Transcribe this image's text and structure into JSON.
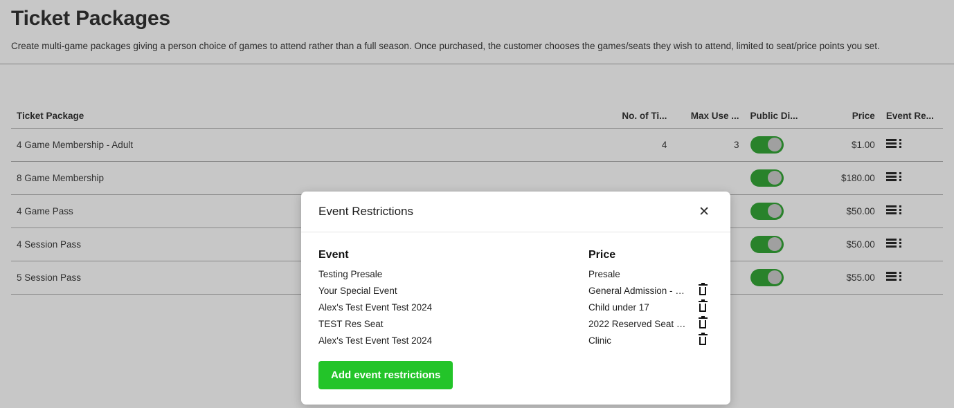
{
  "page": {
    "title": "Ticket Packages",
    "subtitle": "Create multi-game packages giving a person choice of games to attend rather than a full season. Once purchased, the customer chooses the games/seats they wish to attend, limited to seat/price points you set."
  },
  "table": {
    "headers": {
      "ticket_package": "Ticket Package",
      "no_of_tickets": "No. of Ti...",
      "max_use": "Max Use ...",
      "public_display": "Public Di...",
      "price": "Price",
      "event_restrictions": "Event Re..."
    },
    "rows": [
      {
        "name": "4 Game Membership - Adult",
        "no_of_tickets": "4",
        "max_use": "3",
        "public_display": "on",
        "price": "$1.00",
        "event_restrictions_icon": "list-lines-icon"
      },
      {
        "name": "8 Game Membership",
        "no_of_tickets": "",
        "max_use": "",
        "public_display": "on",
        "price": "$180.00",
        "event_restrictions_icon": "list-lines-icon"
      },
      {
        "name": "4 Game Pass",
        "no_of_tickets": "",
        "max_use": "",
        "public_display": "on",
        "price": "$50.00",
        "event_restrictions_icon": "list-lines-icon"
      },
      {
        "name": "4 Session Pass",
        "no_of_tickets": "",
        "max_use": "",
        "public_display": "on",
        "price": "$50.00",
        "event_restrictions_icon": "list-lines-icon"
      },
      {
        "name": "5 Session Pass",
        "no_of_tickets": "",
        "max_use": "",
        "public_display": "on",
        "price": "$55.00",
        "event_restrictions_icon": "list-lines-icon"
      }
    ]
  },
  "modal": {
    "title": "Event Restrictions",
    "close_icon": "close-icon",
    "columns": {
      "event": "Event",
      "price": "Price"
    },
    "rows": [
      {
        "event": "Testing Presale",
        "price": "Presale",
        "has_delete": false
      },
      {
        "event": "Your Special Event",
        "price": "General Admission - Pr...",
        "has_delete": true
      },
      {
        "event": "Alex's Test Event Test 2024",
        "price": "Child under 17",
        "has_delete": true
      },
      {
        "event": "TEST Res Seat",
        "price": "2022 Reserved Seat - ...",
        "has_delete": true
      },
      {
        "event": "Alex's Test Event Test 2024",
        "price": "Clinic",
        "has_delete": true
      }
    ],
    "add_button_label": "Add event restrictions"
  },
  "colors": {
    "toggle_on": "#1d9c20",
    "primary_button": "#23c429",
    "page_background": "#ffffff",
    "scrim": "rgba(70,70,70,0.30)",
    "text": "#1b1b1b"
  }
}
